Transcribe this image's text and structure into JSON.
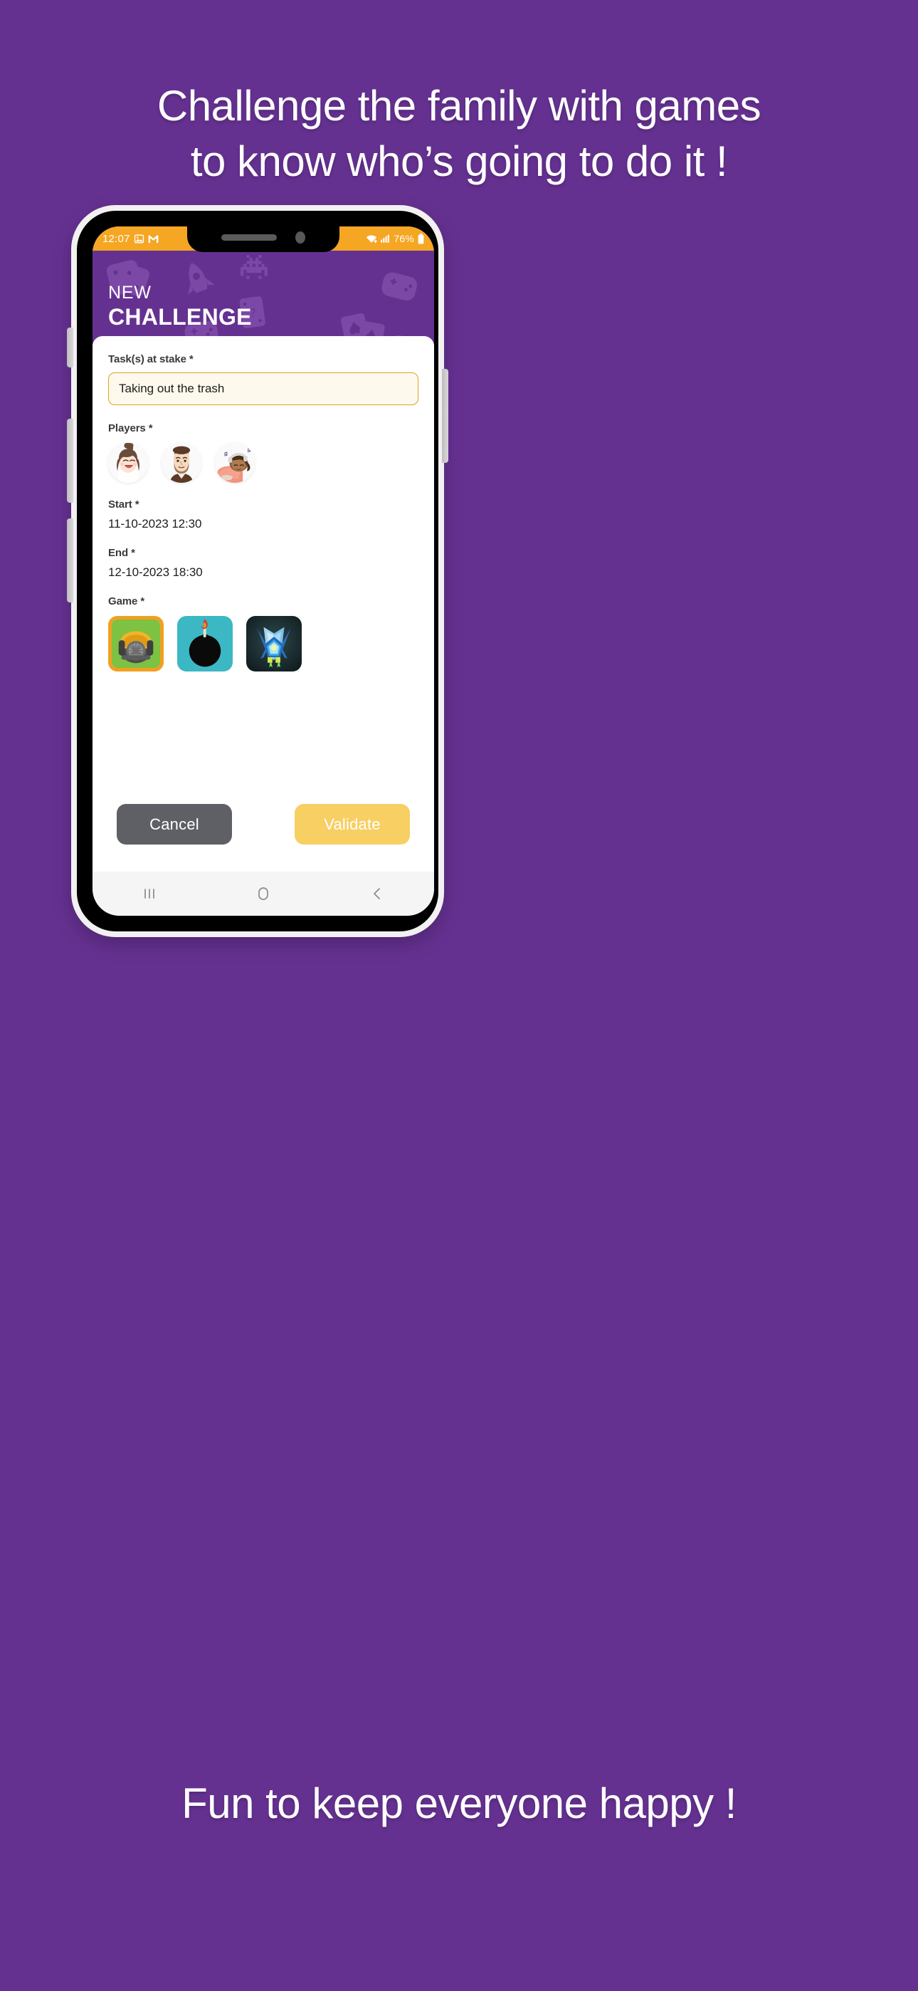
{
  "promo": {
    "top_line1": "Challenge the family with games",
    "top_line2": "to know who’s going to do it !",
    "bottom": "Fun to keep everyone happy !"
  },
  "colors": {
    "background_purple": "#653191",
    "header_purple": "#653191",
    "status_bar_orange": "#f5a623",
    "accent_yellow": "#f8cf63",
    "input_border": "#d9a521",
    "input_fill": "#fdf9ec",
    "cancel_gray": "#5f6065",
    "selected_tile_border": "#f0a020"
  },
  "statusbar": {
    "time": "12:07",
    "battery_percent": "76%",
    "icons": [
      "gallery-icon",
      "gmail-icon",
      "wifi-icon",
      "signal-icon",
      "battery-icon"
    ]
  },
  "header": {
    "title_small": "NEW",
    "title_large": "CHALLENGE"
  },
  "form": {
    "task": {
      "label": "Task(s) at stake *",
      "value": "Taking out the trash",
      "placeholder": "Taking out the trash"
    },
    "players": {
      "label": "Players *",
      "avatars": [
        {
          "name": "avatar-woman-updo"
        },
        {
          "name": "avatar-bearded-man"
        },
        {
          "name": "avatar-girl-headphones"
        }
      ]
    },
    "start": {
      "label": "Start *",
      "value": "11-10-2023 12:30"
    },
    "end": {
      "label": "End *",
      "value": "12-10-2023 18:30"
    },
    "game": {
      "label": "Game *",
      "tiles": [
        {
          "name": "game-lawnmower",
          "selected": true
        },
        {
          "name": "game-bomb",
          "selected": false
        },
        {
          "name": "game-spaceship",
          "selected": false
        }
      ]
    }
  },
  "actions": {
    "cancel_label": "Cancel",
    "validate_label": "Validate"
  },
  "navbar": {
    "recents": "recents-icon",
    "home": "home-icon",
    "back": "back-icon"
  }
}
